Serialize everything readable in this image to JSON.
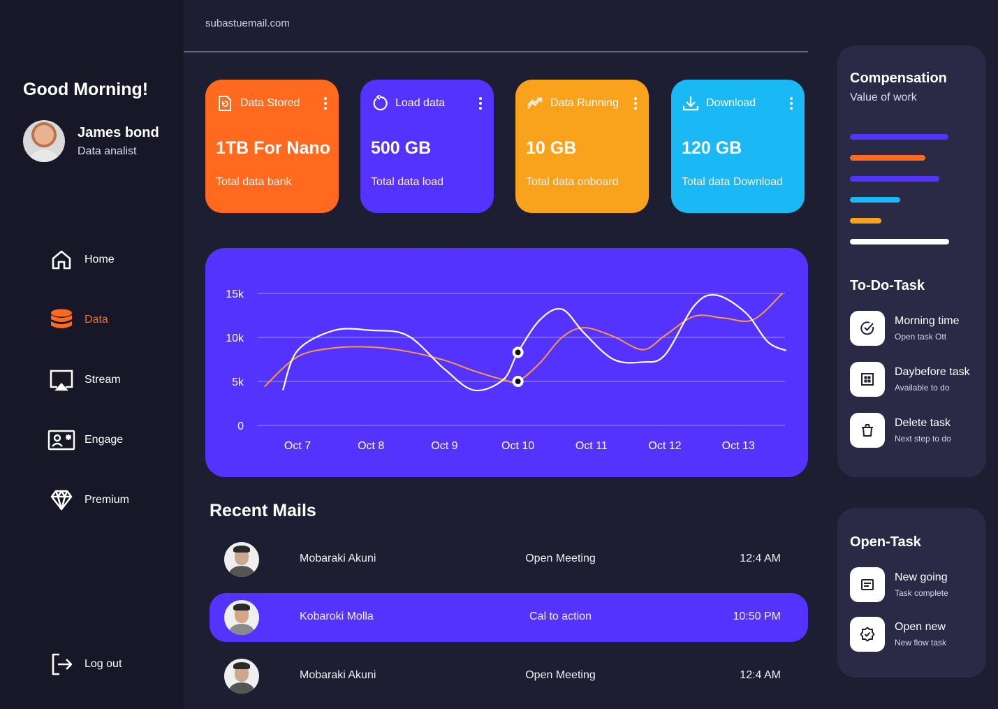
{
  "header": {
    "email": "subastuemail.com"
  },
  "sidebar": {
    "greeting": "Good Morning!",
    "user": {
      "name": "James bond",
      "role": "Data analist"
    },
    "nav": [
      {
        "label": "Home",
        "icon": "home-icon",
        "active": false
      },
      {
        "label": "Data",
        "icon": "database-icon",
        "active": true
      },
      {
        "label": "Stream",
        "icon": "stream-icon",
        "active": false
      },
      {
        "label": "Engage",
        "icon": "engage-icon",
        "active": false
      },
      {
        "label": "Premium",
        "icon": "diamond-icon",
        "active": false
      }
    ],
    "logout": "Log out"
  },
  "cards": [
    {
      "title": "Data Stored",
      "value": "1TB For Nano",
      "sub": "Total data bank",
      "color": "#ff6a1f",
      "icon": "file-icon"
    },
    {
      "title": "Load data",
      "value": "500 GB",
      "sub": "Total data load",
      "color": "#5533ff",
      "icon": "refresh-icon"
    },
    {
      "title": "Data Running",
      "value": "10 GB",
      "sub": "Total data onboard",
      "color": "#f9a21b",
      "icon": "trend-icon"
    },
    {
      "title": "Download",
      "value": "120 GB",
      "sub": "Total data Download",
      "color": "#1ab8f4",
      "icon": "download-icon"
    }
  ],
  "chart_data": {
    "type": "line",
    "categories": [
      "Oct 7",
      "Oct 8",
      "Oct  9",
      "Oct 10",
      "Oct 11",
      "Oct 12",
      "Oct 13"
    ],
    "yticks": [
      "0",
      "5k",
      "10k",
      "15k"
    ],
    "ylim": [
      0,
      15000
    ],
    "grid": true,
    "series": [
      {
        "color": "#ffffff",
        "x": [
          6.8,
          7.0,
          7.5,
          8.0,
          8.5,
          9.0,
          9.4,
          9.8,
          10.0,
          10.3,
          10.6,
          10.9,
          11.3,
          11.7,
          12.0,
          12.4,
          12.7,
          13.1,
          13.4,
          13.65
        ],
        "values": [
          4000,
          8500,
          10800,
          10800,
          10200,
          6400,
          4000,
          5200,
          8300,
          12000,
          13200,
          10500,
          7500,
          7200,
          8000,
          13600,
          14800,
          12800,
          9500,
          8500
        ]
      },
      {
        "color": "#ff9a3c",
        "x": [
          6.55,
          7.0,
          7.5,
          8.0,
          8.5,
          9.0,
          9.4,
          9.8,
          10.0,
          10.3,
          10.6,
          10.9,
          11.3,
          11.7,
          12.0,
          12.4,
          12.8,
          13.2,
          13.6
        ],
        "values": [
          4400,
          7800,
          8800,
          8900,
          8400,
          7400,
          6200,
          5200,
          5000,
          7100,
          10000,
          11100,
          10100,
          8600,
          10200,
          12400,
          12200,
          12000,
          15000
        ]
      }
    ],
    "highlighted_x": 10.0
  },
  "mails": {
    "title": "Recent Mails",
    "rows": [
      {
        "name": "Mobaraki Akuni",
        "subject": "Open Meeting",
        "time": "12:4 AM",
        "highlight": false
      },
      {
        "name": "Kobaroki Molla",
        "subject": "Cal to action",
        "time": "10:50 PM",
        "highlight": true
      },
      {
        "name": "Mobaraki Akuni",
        "subject": "Open Meeting",
        "time": "12:4 AM",
        "highlight": false
      }
    ]
  },
  "compensation": {
    "title": "Compensation",
    "subtitle": "Value of work",
    "bars": [
      {
        "color": "#5533ff",
        "value": 0.99
      },
      {
        "color": "#ff6a1f",
        "value": 0.76
      },
      {
        "color": "#5533ff",
        "value": 0.9
      },
      {
        "color": "#1ab8f4",
        "value": 0.51
      },
      {
        "color": "#f9a21b",
        "value": 0.32
      },
      {
        "color": "#ffffff",
        "value": 1.0
      }
    ]
  },
  "todo": {
    "title": "To-Do-Task",
    "tasks": [
      {
        "title": "Morning time",
        "sub": "Open task Ott",
        "icon": "check-circle-icon"
      },
      {
        "title": "Daybefore task",
        "sub": "Available to do",
        "icon": "grid-icon"
      },
      {
        "title": "Delete task",
        "sub": "Next step to do",
        "icon": "trash-icon"
      }
    ]
  },
  "open_task": {
    "title": "Open-Task",
    "tasks": [
      {
        "title": "New going",
        "sub": "Task complete",
        "icon": "note-icon"
      },
      {
        "title": "Open new",
        "sub": "New flow task",
        "icon": "badge-check-icon"
      }
    ]
  }
}
